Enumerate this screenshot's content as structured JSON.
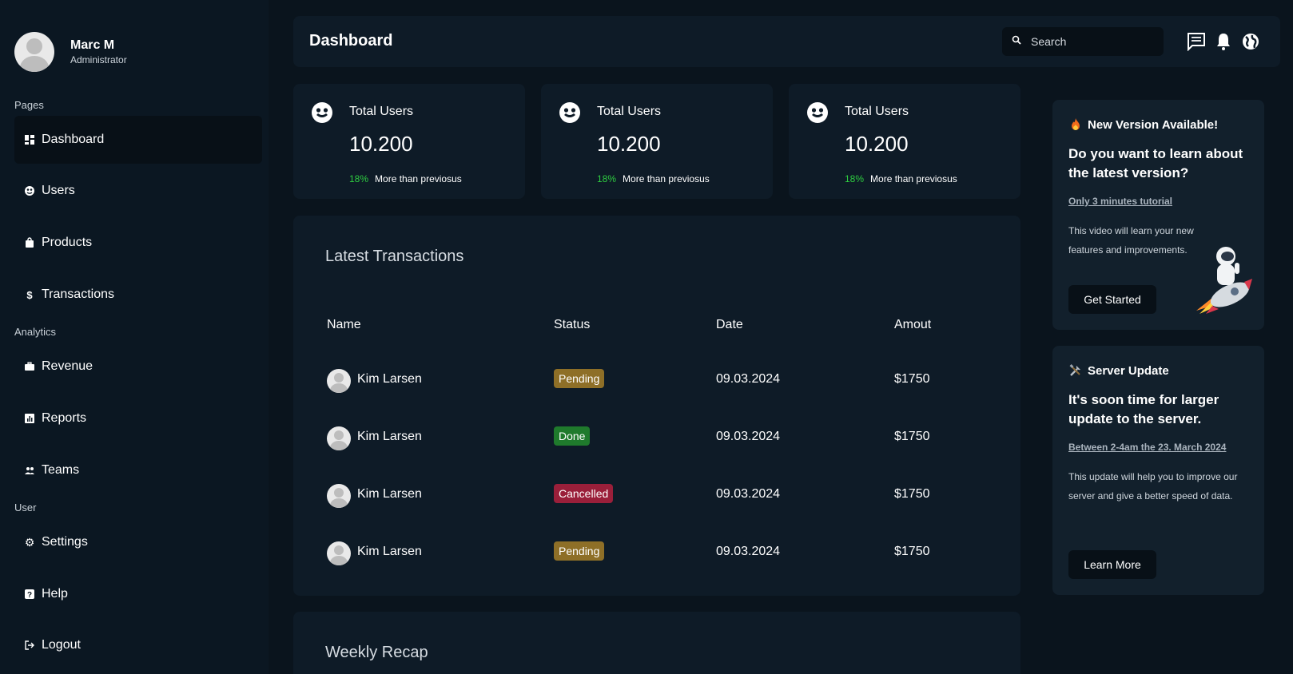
{
  "user": {
    "name": "Marc M",
    "role": "Administrator"
  },
  "sidebar": {
    "sections": [
      "Pages",
      "Analytics",
      "User"
    ],
    "items": [
      {
        "label": "Dashboard",
        "icon": "dashboard-icon",
        "active": true
      },
      {
        "label": "Users",
        "icon": "users-icon"
      },
      {
        "label": "Products",
        "icon": "bag-icon"
      },
      {
        "label": "Transactions",
        "icon": "dollar-icon"
      },
      {
        "label": "Revenue",
        "icon": "briefcase-icon"
      },
      {
        "label": "Reports",
        "icon": "chart-icon"
      },
      {
        "label": "Teams",
        "icon": "team-icon"
      },
      {
        "label": "Settings",
        "icon": "gear-icon"
      },
      {
        "label": "Help",
        "icon": "help-icon"
      },
      {
        "label": "Logout",
        "icon": "logout-icon"
      }
    ]
  },
  "header": {
    "title": "Dashboard",
    "search_placeholder": "Search",
    "icons": [
      "messages-icon",
      "bell-icon",
      "globe-icon"
    ]
  },
  "stats": [
    {
      "label": "Total Users",
      "value": "10.200",
      "pct": "18%",
      "note": "More than previosus"
    },
    {
      "label": "Total Users",
      "value": "10.200",
      "pct": "18%",
      "note": "More than previosus"
    },
    {
      "label": "Total Users",
      "value": "10.200",
      "pct": "18%",
      "note": "More than previosus"
    }
  ],
  "transactions": {
    "title": "Latest Transactions",
    "columns": [
      "Name",
      "Status",
      "Date",
      "Amout"
    ],
    "rows": [
      {
        "name": "Kim Larsen",
        "status": "Pending",
        "date": "09.03.2024",
        "amount": "$1750"
      },
      {
        "name": "Kim Larsen",
        "status": "Done",
        "date": "09.03.2024",
        "amount": "$1750"
      },
      {
        "name": "Kim Larsen",
        "status": "Cancelled",
        "date": "09.03.2024",
        "amount": "$1750"
      },
      {
        "name": "Kim Larsen",
        "status": "Pending",
        "date": "09.03.2024",
        "amount": "$1750"
      }
    ]
  },
  "recap": {
    "title": "Weekly Recap"
  },
  "cards": [
    {
      "title": "New Version Available!",
      "heading": "Do you want to learn about the latest version?",
      "link": "Only 3 minutes tutorial",
      "desc": "This video will learn your new features and improvements.",
      "button": "Get Started"
    },
    {
      "title": "Server Update",
      "heading": "It's soon time for larger update to the server.",
      "link": "Between 2-4am the 23. March 2024",
      "desc": "This update will help you to improve our server and give a better speed of data.",
      "button": "Learn More"
    }
  ],
  "colors": {
    "pending": "#8e6f27",
    "done": "#1f7a2c",
    "cancelled": "#9a1f3a",
    "accent_green": "#2ecc40"
  }
}
